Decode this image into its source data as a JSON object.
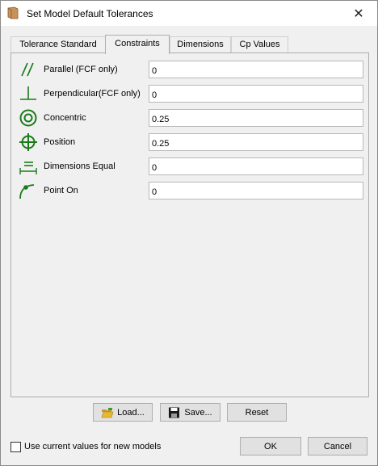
{
  "window": {
    "title": "Set Model Default Tolerances",
    "close_label": "✕"
  },
  "tabs": [
    {
      "label": "Tolerance Standard"
    },
    {
      "label": "Constraints",
      "active": true
    },
    {
      "label": "Dimensions"
    },
    {
      "label": "Cp Values"
    }
  ],
  "rows": [
    {
      "label": "Parallel (FCF only)",
      "value": "0",
      "icon": "parallel-icon"
    },
    {
      "label": "Perpendicular(FCF only)",
      "value": "0",
      "icon": "perpendicular-icon"
    },
    {
      "label": "Concentric",
      "value": "0.25",
      "icon": "concentric-icon"
    },
    {
      "label": "Position",
      "value": "0.25",
      "icon": "position-icon"
    },
    {
      "label": "Dimensions Equal",
      "value": "0",
      "icon": "dimensions-equal-icon"
    },
    {
      "label": "Point On",
      "value": "0",
      "icon": "point-on-icon"
    }
  ],
  "buttons": {
    "load": "Load...",
    "save": "Save...",
    "reset": "Reset",
    "ok": "OK",
    "cancel": "Cancel"
  },
  "use_current": {
    "label": "Use current values for new models",
    "checked": false
  },
  "colors": {
    "icon_green": "#1a7a1a",
    "folder_yellow": "#e8b832"
  }
}
